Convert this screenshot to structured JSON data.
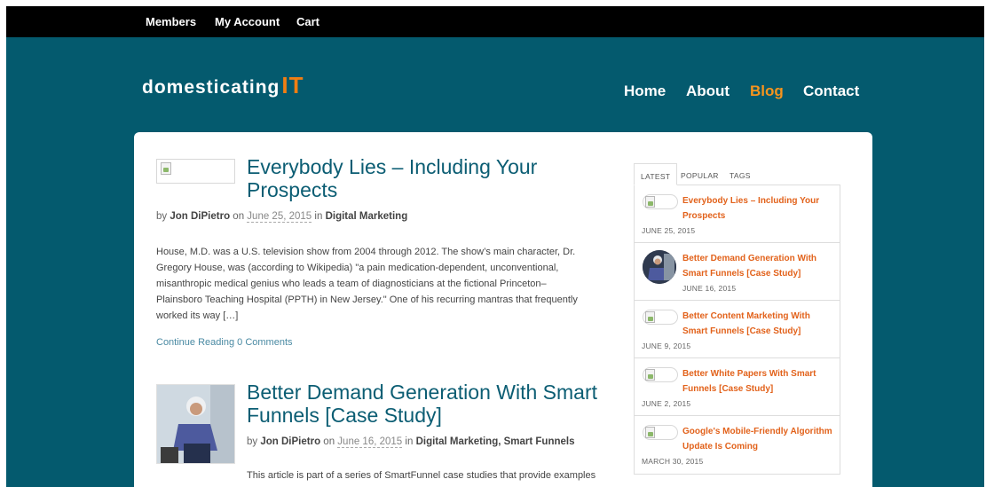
{
  "topbar": {
    "members": "Members",
    "account": "My Account",
    "cart": "Cart"
  },
  "logo": {
    "word": "domesticating",
    "accent": "IT"
  },
  "nav": [
    {
      "label": "Home"
    },
    {
      "label": "About"
    },
    {
      "label": "Blog",
      "active": true
    },
    {
      "label": "Contact"
    }
  ],
  "posts": [
    {
      "title": "Everybody Lies – Including Your Prospects",
      "by": "by",
      "author": "Jon DiPietro",
      "on": "on",
      "date": "June 25, 2015",
      "in": "in",
      "categories": "Digital Marketing",
      "excerpt": "House, M.D. was a U.S. television show from 2004 through 2012. The show’s main character, Dr. Gregory House, was (according to Wikipedia) \"a pain medication-dependent, unconventional, misanthropic medical genius who leads a team of diagnosticians at the fictional Princeton–Plainsboro Teaching Hospital (PPTH) in New Jersey.\" One of his recurring mantras that frequently worked its way […]",
      "continue": "Continue Reading",
      "comments": "0 Comments"
    },
    {
      "title": "Better Demand Generation With Smart Funnels [Case Study]",
      "by": "by",
      "author": "Jon DiPietro",
      "on": "on",
      "date": "June 16, 2015",
      "in": "in",
      "categories": "Digital Marketing, Smart Funnels",
      "excerpt": "This article is part of a series of SmartFunnel case studies that provide examples"
    }
  ],
  "sidebar": {
    "tabs": [
      "LATEST",
      "POPULAR",
      "TAGS"
    ],
    "items": [
      {
        "title": "Everybody Lies – Including Your Prospects",
        "date": "JUNE 25, 2015"
      },
      {
        "title": "Better Demand Generation With Smart Funnels [Case Study]",
        "date": "JUNE 16, 2015"
      },
      {
        "title": "Better Content Marketing With Smart Funnels [Case Study]",
        "date": "JUNE 9, 2015"
      },
      {
        "title": "Better White Papers With Smart Funnels [Case Study]",
        "date": "JUNE 2, 2015"
      },
      {
        "title": "Google's Mobile-Friendly Algorithm Update Is Coming",
        "date": "MARCH 30, 2015"
      }
    ]
  },
  "colors": {
    "header_bg": "#045a6e",
    "topbar_bg": "#000000",
    "accent": "#f7941d",
    "title": "#0b5d73",
    "sidebar_link": "#e2621b"
  }
}
